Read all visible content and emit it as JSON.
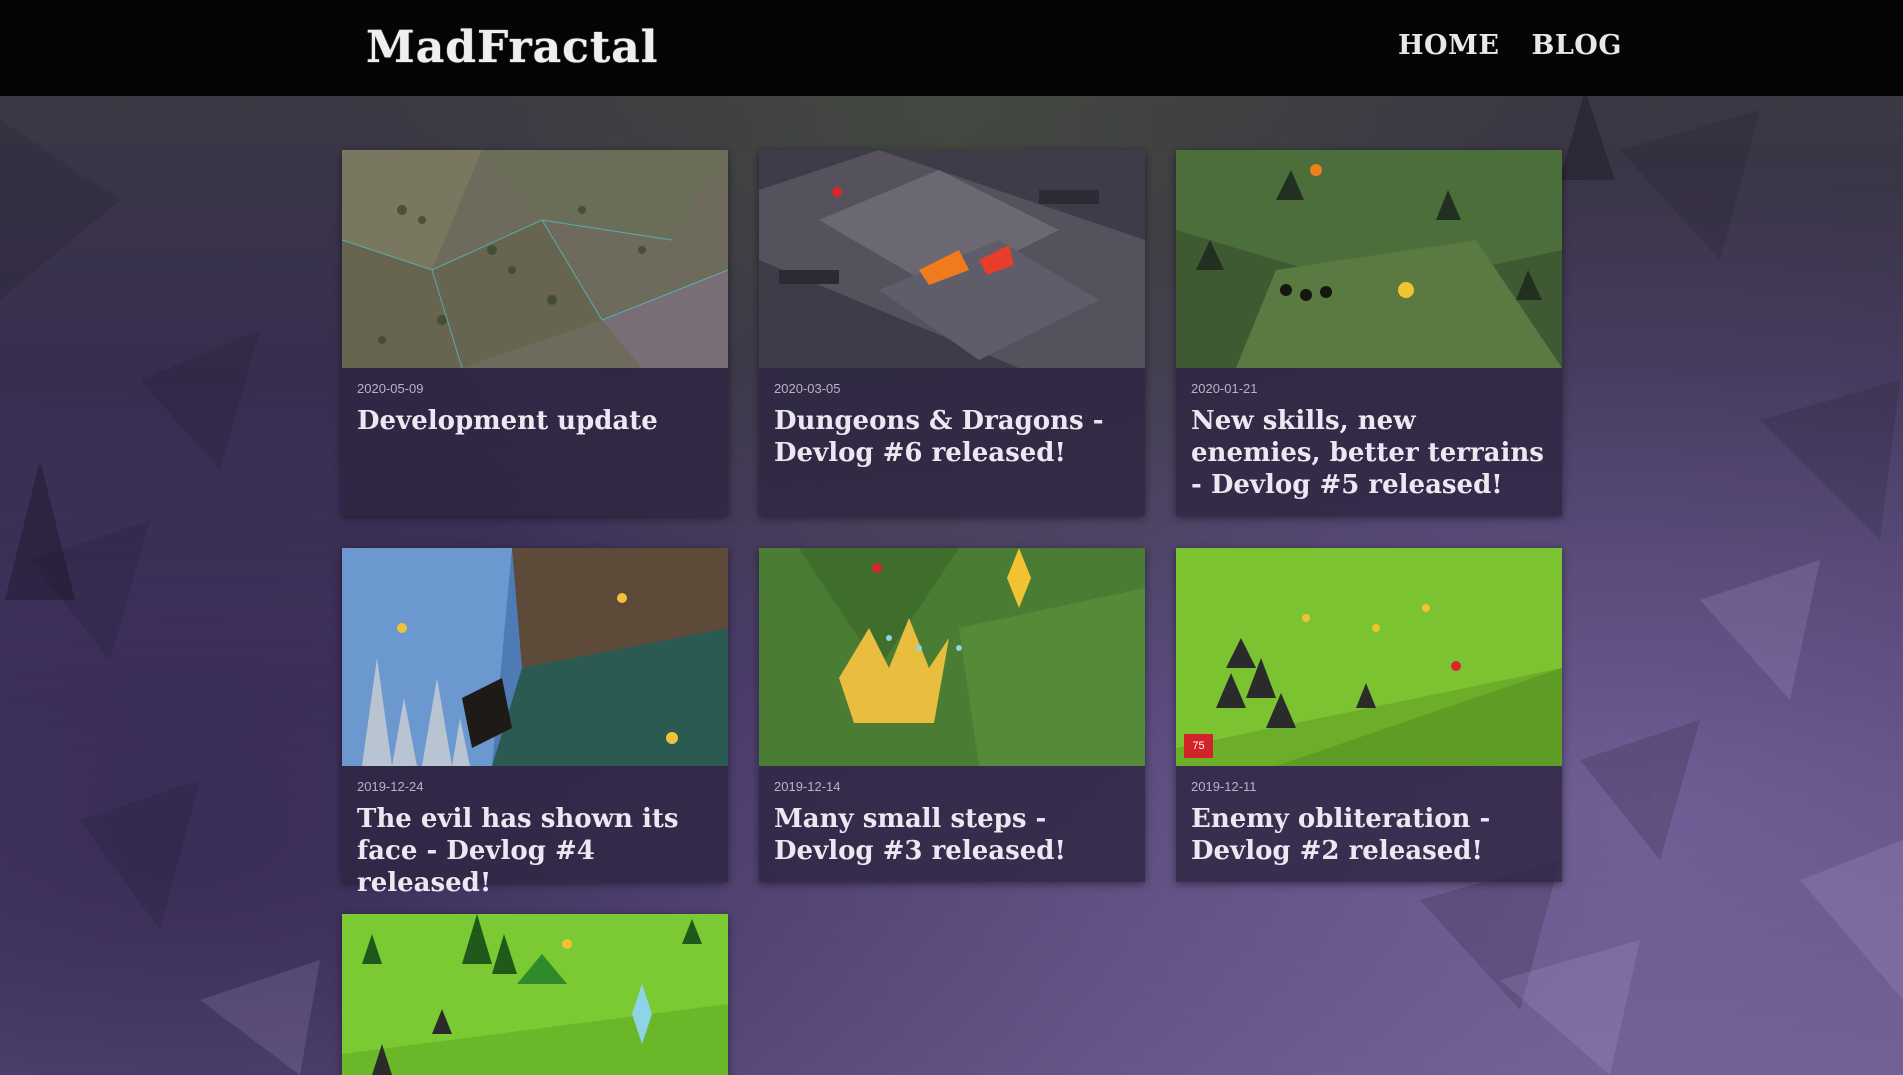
{
  "site": {
    "logo": "MadFractal"
  },
  "nav": [
    {
      "label": "HOME"
    },
    {
      "label": "BLOG"
    }
  ],
  "posts": [
    {
      "date": "2020-05-09",
      "title": "Development update"
    },
    {
      "date": "2020-03-05",
      "title": "Dungeons & Dragons - Devlog #6 released!"
    },
    {
      "date": "2020-01-21",
      "title": "New skills, new enemies, better terrains - Devlog #5 released!"
    },
    {
      "date": "2019-12-24",
      "title": "The evil has shown its face - Devlog #4 released!"
    },
    {
      "date": "2019-12-14",
      "title": "Many small steps - Devlog #3 released!"
    },
    {
      "date": "2019-12-11",
      "title": "Enemy obliteration - Devlog #2 released!",
      "badge": "75"
    },
    {
      "date": "",
      "title": ""
    }
  ]
}
